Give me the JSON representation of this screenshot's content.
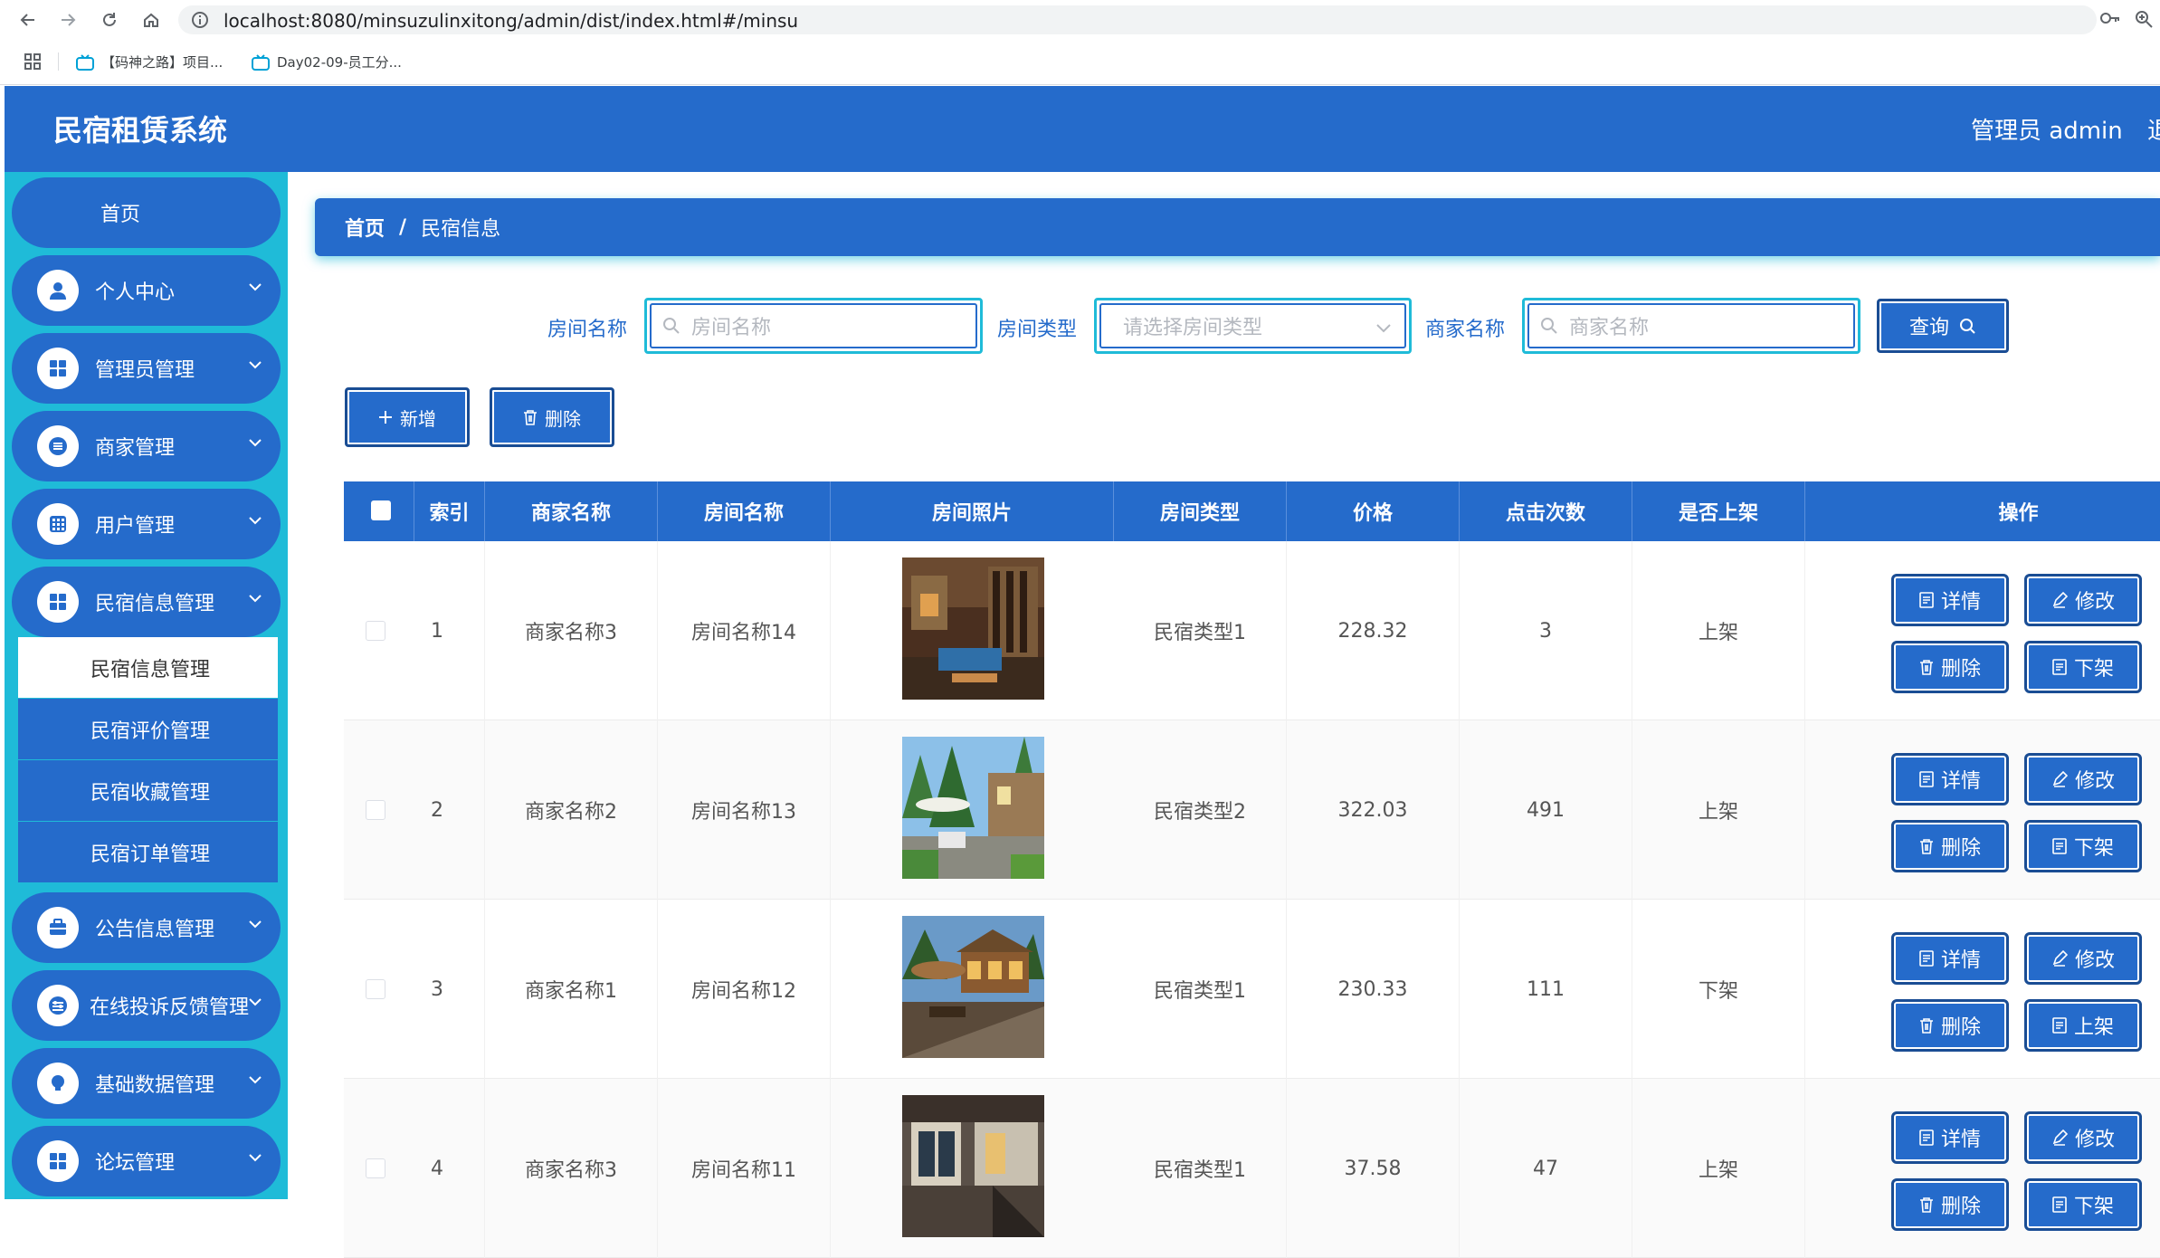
{
  "browser": {
    "url": "localhost:8080/minsuzulinxitong/admin/dist/index.html#/minsu",
    "bookmarks": [
      "【码神之路】项目...",
      "Day02-09-员工分..."
    ]
  },
  "header": {
    "title": "民宿租赁系统",
    "user": "管理员 admin",
    "logout": "退出登录"
  },
  "sidebar": {
    "home": "首页",
    "menus": [
      {
        "label": "个人中心",
        "icon": "user-icon"
      },
      {
        "label": "管理员管理",
        "icon": "grid-icon"
      },
      {
        "label": "商家管理",
        "icon": "list-icon"
      },
      {
        "label": "用户管理",
        "icon": "apps-icon"
      },
      {
        "label": "民宿信息管理",
        "icon": "grid-icon"
      },
      {
        "label": "公告信息管理",
        "icon": "briefcase-icon"
      },
      {
        "label": "在线投诉反馈管理",
        "icon": "sliders-icon"
      },
      {
        "label": "基础数据管理",
        "icon": "bulb-icon"
      },
      {
        "label": "论坛管理",
        "icon": "grid-icon"
      }
    ],
    "submenus": [
      "民宿信息管理",
      "民宿评价管理",
      "民宿收藏管理",
      "民宿订单管理"
    ]
  },
  "breadcrumb": {
    "home": "首页",
    "separator": "/",
    "current": "民宿信息"
  },
  "search": {
    "room_name_label": "房间名称",
    "room_name_placeholder": "房间名称",
    "room_type_label": "房间类型",
    "room_type_placeholder": "请选择房间类型",
    "merchant_label": "商家名称",
    "merchant_placeholder": "商家名称",
    "button": "查询"
  },
  "actions": {
    "add": "新增",
    "delete": "删除"
  },
  "table": {
    "columns": [
      "索引",
      "商家名称",
      "房间名称",
      "房间照片",
      "房间类型",
      "价格",
      "点击次数",
      "是否上架",
      "操作"
    ],
    "rows": [
      {
        "index": "1",
        "merchant": "商家名称3",
        "room": "房间名称14",
        "type": "民宿类型1",
        "price": "228.32",
        "clicks": "3",
        "status": "上架",
        "toggle": "下架"
      },
      {
        "index": "2",
        "merchant": "商家名称2",
        "room": "房间名称13",
        "type": "民宿类型2",
        "price": "322.03",
        "clicks": "491",
        "status": "上架",
        "toggle": "下架"
      },
      {
        "index": "3",
        "merchant": "商家名称1",
        "room": "房间名称12",
        "type": "民宿类型1",
        "price": "230.33",
        "clicks": "111",
        "status": "下架",
        "toggle": "上架"
      },
      {
        "index": "4",
        "merchant": "商家名称3",
        "room": "房间名称11",
        "type": "民宿类型1",
        "price": "37.58",
        "clicks": "47",
        "status": "上架",
        "toggle": "下架"
      }
    ],
    "op_labels": {
      "detail": "详情",
      "edit": "修改",
      "delete": "删除"
    }
  },
  "colors": {
    "primary": "#256bcb",
    "sidebar_bg": "#1fbbd8"
  }
}
